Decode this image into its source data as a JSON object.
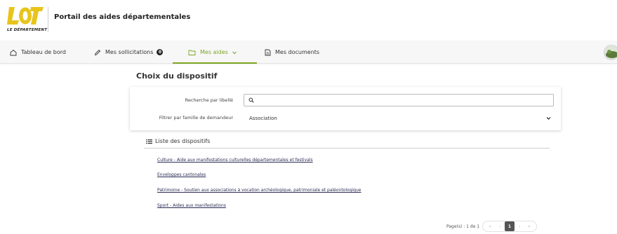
{
  "header": {
    "logo_text": "LOT",
    "logo_subtitle": "LE DÉPARTEMENT",
    "portal_title": "Portail des aides départementales"
  },
  "nav": {
    "items": [
      {
        "label": "Tableau de bord",
        "icon": "home-icon"
      },
      {
        "label": "Mes sollicitations",
        "icon": "pencil-icon",
        "badge": "0"
      },
      {
        "label": "Mes aides",
        "icon": "folder-icon",
        "active": true
      },
      {
        "label": "Mes documents",
        "icon": "document-icon"
      }
    ]
  },
  "main": {
    "title": "Choix du dispositif",
    "search_label": "Recherche par libellé",
    "search_value": "",
    "filter_label": "Filtrer par famille de demandeur",
    "filter_value": "Association",
    "list_title": "Liste des dispositifs",
    "list_items": [
      "Culture - Aide aux manifestations culturelles départementales et festivals",
      "Enveloppes cantonales",
      "Patrimoine - Soutien aux associations à vocation archéologique, patrimoniale et paléontologique",
      "Sport - Aides aux manifestations"
    ]
  },
  "pagination": {
    "text": "Page(s) : 1 de 1",
    "first": "«",
    "prev": "‹",
    "current": "1",
    "next": "›",
    "last": "»"
  },
  "colors": {
    "accent": "#7da425",
    "logo_yellow": "#e8c41a"
  }
}
